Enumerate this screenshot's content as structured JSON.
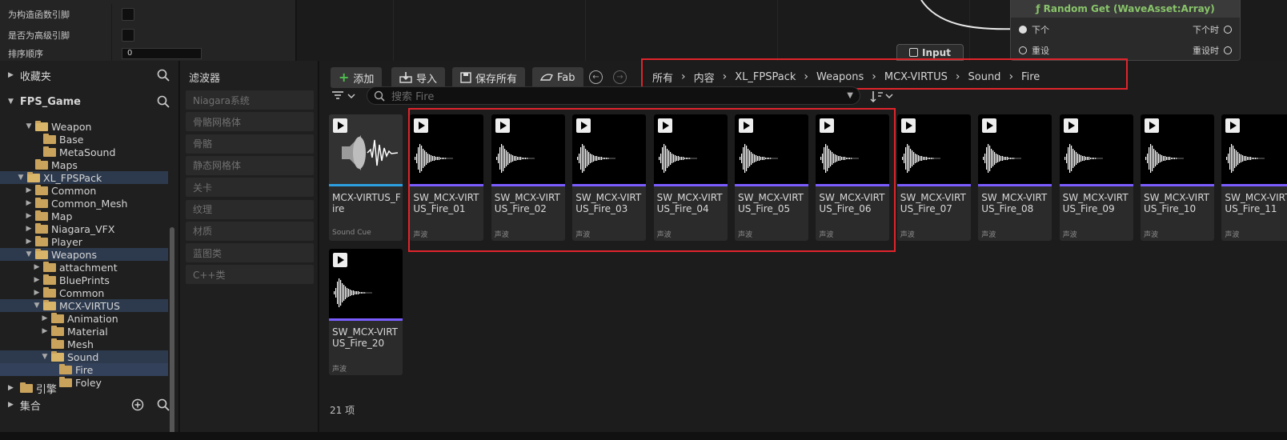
{
  "details": {
    "rows": [
      {
        "label": "为构造函数引脚",
        "type": "checkbox"
      },
      {
        "label": "是否为高级引脚",
        "type": "checkbox"
      },
      {
        "label": "排序顺序",
        "type": "number",
        "value": "0"
      }
    ]
  },
  "graph": {
    "node_title": "ƒ Random Get (WaveAsset:Array)",
    "pins_left": [
      "下个",
      "重设"
    ],
    "pins_right": [
      "下个时",
      "重设时"
    ],
    "input_node": "Input"
  },
  "left_panel": {
    "favorites": "收藏夹",
    "project": "FPS_Game",
    "engine": "引擎",
    "collections": "集合",
    "tree": [
      {
        "label": "Weapon",
        "depth": 1,
        "open": true,
        "arrow": "▼"
      },
      {
        "label": "Base",
        "depth": 2,
        "arrow": ""
      },
      {
        "label": "MetaSound",
        "depth": 2,
        "arrow": ""
      },
      {
        "label": "Maps",
        "depth": 1,
        "arrow": ""
      },
      {
        "label": "XL_FPSPack",
        "depth": 0,
        "open": true,
        "arrow": "▼",
        "sel": true
      },
      {
        "label": "Common",
        "depth": 1,
        "arrow": "▶"
      },
      {
        "label": "Common_Mesh",
        "depth": 1,
        "arrow": "▶"
      },
      {
        "label": "Map",
        "depth": 1,
        "arrow": "▶"
      },
      {
        "label": "Niagara_VFX",
        "depth": 1,
        "arrow": "▶"
      },
      {
        "label": "Player",
        "depth": 1,
        "arrow": "▶"
      },
      {
        "label": "Weapons",
        "depth": 1,
        "open": true,
        "arrow": "▼",
        "sel": true
      },
      {
        "label": "attachment",
        "depth": 2,
        "arrow": "▶"
      },
      {
        "label": "BluePrints",
        "depth": 2,
        "arrow": "▶"
      },
      {
        "label": "Common",
        "depth": 2,
        "arrow": "▶"
      },
      {
        "label": "MCX-VIRTUS",
        "depth": 2,
        "open": true,
        "arrow": "▼",
        "sel": true
      },
      {
        "label": "Animation",
        "depth": 3,
        "arrow": "▶"
      },
      {
        "label": "Material",
        "depth": 3,
        "arrow": "▶"
      },
      {
        "label": "Mesh",
        "depth": 3,
        "arrow": ""
      },
      {
        "label": "Sound",
        "depth": 3,
        "open": true,
        "arrow": "▼",
        "sel": true
      },
      {
        "label": "Fire",
        "depth": 4,
        "arrow": "",
        "cur": true
      },
      {
        "label": "Foley",
        "depth": 4,
        "arrow": ""
      }
    ]
  },
  "filters": {
    "title": "滤波器",
    "items": [
      "Niagara系统",
      "骨骼网格体",
      "骨骼",
      "静态网格体",
      "关卡",
      "纹理",
      "材质",
      "蓝图类",
      "C++类"
    ]
  },
  "toolbar": {
    "add": "添加",
    "import": "导入",
    "save_all": "保存所有",
    "fab": "Fab"
  },
  "breadcrumbs": [
    "所有",
    "内容",
    "XL_FPSPack",
    "Weapons",
    "MCX-VIRTUS",
    "Sound",
    "Fire"
  ],
  "search": {
    "placeholder": "搜索 Fire"
  },
  "assets": [
    {
      "name": "MCX-VIRTUS_Fire",
      "type": "Sound Cue",
      "kind": "cue"
    },
    {
      "name": "SW_MCX-VIRTUS_Fire_01",
      "type": "声波",
      "kind": "wave"
    },
    {
      "name": "SW_MCX-VIRTUS_Fire_02",
      "type": "声波",
      "kind": "wave"
    },
    {
      "name": "SW_MCX-VIRTUS_Fire_03",
      "type": "声波",
      "kind": "wave"
    },
    {
      "name": "SW_MCX-VIRTUS_Fire_04",
      "type": "声波",
      "kind": "wave"
    },
    {
      "name": "SW_MCX-VIRTUS_Fire_05",
      "type": "声波",
      "kind": "wave"
    },
    {
      "name": "SW_MCX-VIRTUS_Fire_06",
      "type": "声波",
      "kind": "wave"
    },
    {
      "name": "SW_MCX-VIRTUS_Fire_07",
      "type": "声波",
      "kind": "wave"
    },
    {
      "name": "SW_MCX-VIRTUS_Fire_08",
      "type": "声波",
      "kind": "wave"
    },
    {
      "name": "SW_MCX-VIRTUS_Fire_09",
      "type": "声波",
      "kind": "wave"
    },
    {
      "name": "SW_MCX-VIRTUS_Fire_10",
      "type": "声波",
      "kind": "wave"
    },
    {
      "name": "SW_MCX-VIRTUS_Fire_11",
      "type": "声波",
      "kind": "wave"
    },
    {
      "name": "SW_MCX-VIRTUS_Fire_20",
      "type": "声波",
      "kind": "wave"
    }
  ],
  "item_count": "21 项",
  "colors": {
    "highlight": "#e0242b",
    "wave_bar": "#7a5cff",
    "cue_bar": "#2b9fe0",
    "add_plus": "#4fc04f",
    "node_title": "#88c46a"
  }
}
